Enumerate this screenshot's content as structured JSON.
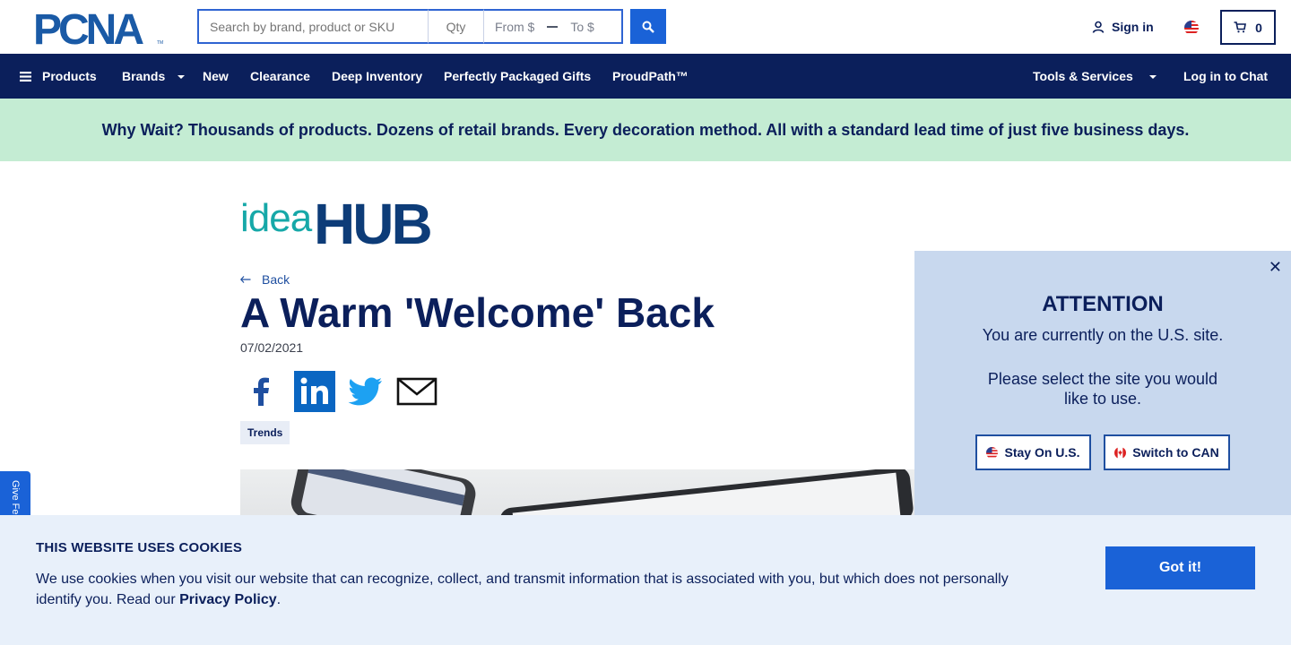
{
  "header": {
    "logo_text": "PCNA",
    "search": {
      "placeholder": "Search by brand, product or SKU",
      "qty_placeholder": "Qty",
      "from_placeholder": "From $",
      "to_placeholder": "To $"
    },
    "signin_label": "Sign in",
    "cart_count": "0"
  },
  "nav": {
    "products": "Products",
    "brands": "Brands",
    "new": "New",
    "clearance": "Clearance",
    "deep_inventory": "Deep Inventory",
    "gifts": "Perfectly Packaged Gifts",
    "proudpath": "ProudPath™",
    "tools": "Tools & Services",
    "chat": "Log in to Chat"
  },
  "banner": {
    "text": "Why Wait? Thousands of products. Dozens of retail brands. Every decoration method. All with a standard lead time of just five business days."
  },
  "article": {
    "brand_light": "idea",
    "brand_bold": "HUB",
    "back_label": "Back",
    "title": "A Warm 'Welcome' Back",
    "date": "07/02/2021",
    "tag": "Trends"
  },
  "feedback": {
    "label": "Give Feedback"
  },
  "modal": {
    "title": "ATTENTION",
    "line1": "You are currently on the U.S. site.",
    "line2": "Please select the site you would like to use.",
    "stay_label": "Stay On U.S.",
    "switch_label": "Switch to CAN"
  },
  "cookie": {
    "title": "THIS WEBSITE USES COOKIES",
    "text": "We use cookies when you visit our website that can recognize, collect, and transmit information that is associated with you, but which does not personally identify you. Read our",
    "link": "Privacy Policy",
    "button": "Got it!"
  },
  "colors": {
    "navy": "#0b1f5b",
    "blue": "#1a62d7",
    "mint": "#c4ecd3",
    "modal_bg": "#c8d8ee",
    "cookie_bg": "#e8f0fa",
    "teal": "#16a8a8"
  }
}
